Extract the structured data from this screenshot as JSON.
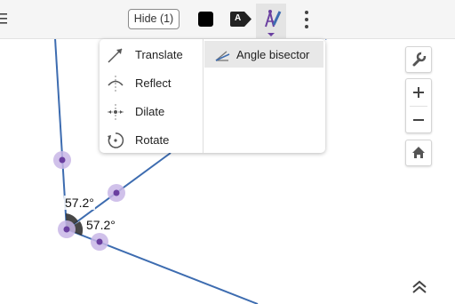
{
  "toolbar": {
    "hide_button_label": "Hide (1)",
    "label_badge_text": "A",
    "color_swatch": "#000000"
  },
  "tool_menu": {
    "left_items": [
      {
        "label": "Translate",
        "icon": "translate-arrow-icon"
      },
      {
        "label": "Reflect",
        "icon": "reflect-icon"
      },
      {
        "label": "Dilate",
        "icon": "dilate-icon"
      },
      {
        "label": "Rotate",
        "icon": "rotate-icon"
      }
    ],
    "right_items": [
      {
        "label": "Angle bisector",
        "icon": "angle-bisector-icon",
        "selected": true
      }
    ]
  },
  "canvas": {
    "angle_labels": [
      "57.2°",
      "57.2°"
    ],
    "line_color": "#3d6cb0",
    "point_color": "#6a3fa0",
    "point_halo_color": "#c8b6e6"
  },
  "side_controls": [
    "wrench-icon",
    "zoom-in-icon",
    "zoom-out-icon",
    "home-icon"
  ]
}
